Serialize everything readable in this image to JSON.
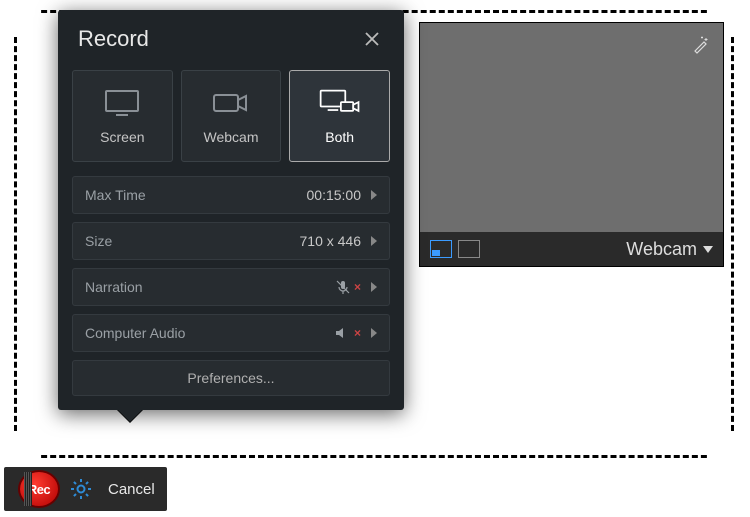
{
  "popup": {
    "title": "Record",
    "modes": {
      "screen": "Screen",
      "webcam": "Webcam",
      "both": "Both"
    },
    "settings": {
      "max_time_label": "Max Time",
      "max_time_value": "00:15:00",
      "size_label": "Size",
      "size_value": "710 x 446",
      "narration_label": "Narration",
      "narration_state": "off",
      "audio_label": "Computer Audio",
      "audio_state": "off"
    },
    "preferences_label": "Preferences..."
  },
  "webcam": {
    "label": "Webcam"
  },
  "bottombar": {
    "rec_label": "Rec",
    "cancel_label": "Cancel"
  },
  "icons": {
    "close": "close-icon",
    "magic": "magic-wand-icon",
    "screen": "monitor-icon",
    "webcam_mode": "camera-icon",
    "both": "monitor-camera-icon",
    "chevron": "chevron-right-icon",
    "mic": "microphone-icon",
    "speaker": "speaker-icon",
    "gear": "gear-icon"
  }
}
